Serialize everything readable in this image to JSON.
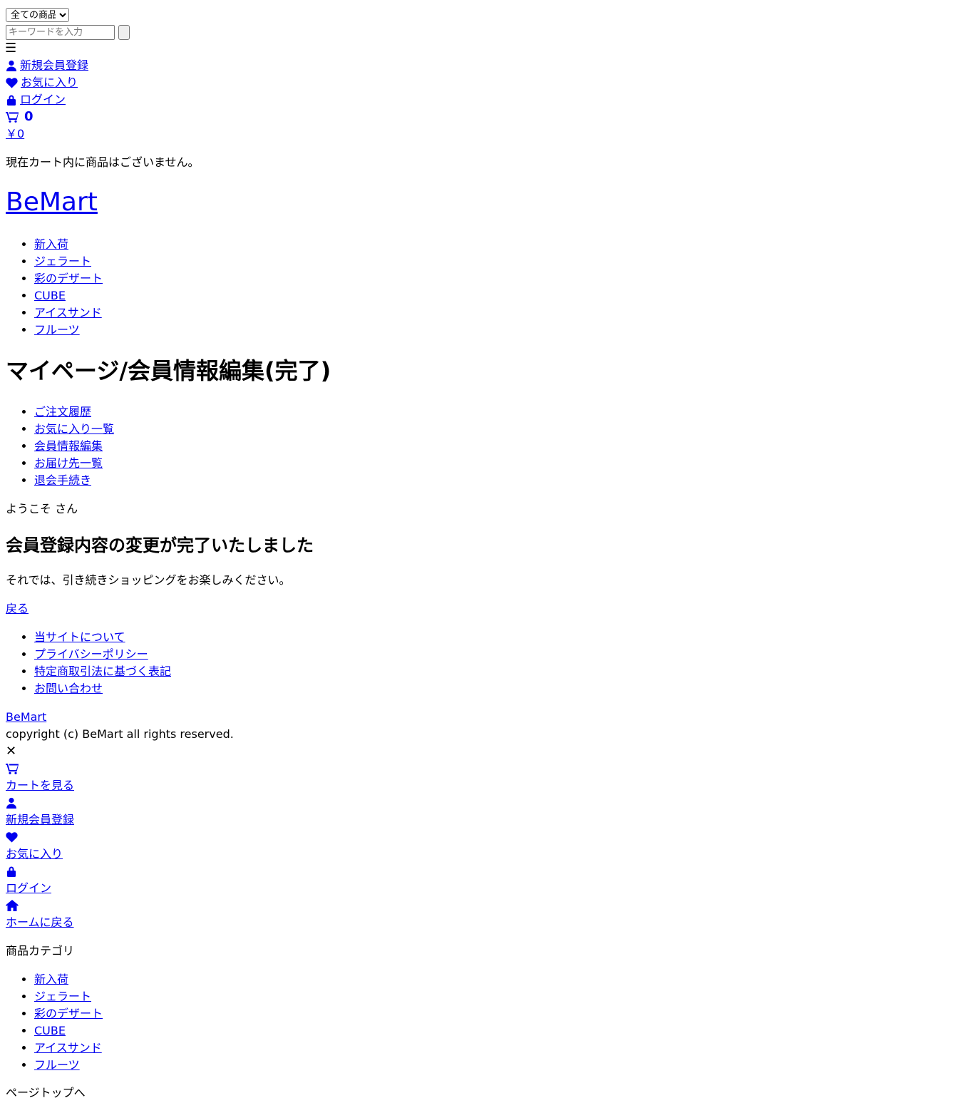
{
  "header": {
    "category_select": {
      "selected": "全ての商品"
    },
    "search": {
      "placeholder": "キーワードを入力"
    },
    "menu_icon": "☰",
    "links": {
      "register": "新規会員登録",
      "favorites": "お気に入り",
      "login": "ログイン"
    },
    "cart": {
      "count": "0",
      "total": "￥0",
      "empty_message": "現在カート内に商品はございません。"
    },
    "logo": "BeMart"
  },
  "categories": [
    "新入荷",
    "ジェラート",
    "彩のデザート",
    "CUBE",
    "アイスサンド",
    "フルーツ"
  ],
  "main": {
    "title": "マイページ/会員情報編集(完了)",
    "mypage_nav": [
      "ご注文履歴",
      "お気に入り一覧",
      "会員情報編集",
      "お届け先一覧",
      "退会手続き"
    ],
    "welcome": "ようこそ さん",
    "done_title": "会員登録内容の変更が完了いたしました",
    "done_message": "それでは、引き続きショッピングをお楽しみください。",
    "back_link": "戻る"
  },
  "footer": {
    "links": [
      "当サイトについて",
      "プライバシーポリシー",
      "特定商取引法に基づく表記",
      "お問い合わせ"
    ],
    "logo": "BeMart",
    "copyright": "copyright (c) BeMart all rights reserved."
  },
  "drawer": {
    "close_icon": "✕",
    "links": {
      "cart": "カートを見る",
      "register": "新規会員登録",
      "favorites": "お気に入り",
      "login": "ログイン",
      "home": "ホームに戻る"
    },
    "category_heading": "商品カテゴリ",
    "categories": [
      "新入荷",
      "ジェラート",
      "彩のデザート",
      "CUBE",
      "アイスサンド",
      "フルーツ"
    ],
    "page_top": "ページトップへ"
  },
  "icons": {
    "menu": "hamburger-icon",
    "user": "user-icon",
    "favorite": "heart-icon",
    "login": "lock-icon",
    "cart": "cart-icon",
    "home": "home-icon",
    "close": "close-icon"
  },
  "colors": {
    "link": "#0000ee",
    "text": "#000000"
  }
}
